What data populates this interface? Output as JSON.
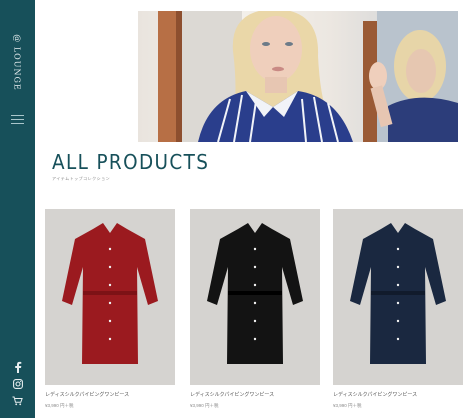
{
  "sidebar": {
    "logo_text": "@ LOUNGE",
    "icons": [
      "menu-icon",
      "facebook-icon",
      "instagram-icon",
      "cart-icon"
    ]
  },
  "hero": {
    "image": "woman in blue-and-white striped pajama shirt beside a mirror"
  },
  "page": {
    "title": "ALL PRODUCTS",
    "subtitle": "アイテムトップコレクション"
  },
  "products": [
    {
      "name": "レディスシルクパイピングワンピース",
      "price": "¥3,990 円＋税",
      "color": "#9b1a1f"
    },
    {
      "name": "レディスシルクパイピングワンピース",
      "price": "¥3,990 円＋税",
      "color": "#131313"
    },
    {
      "name": "レディスシルクパイピングワンピース",
      "price": "¥3,990 円＋税",
      "color": "#1a2840"
    }
  ],
  "colors": {
    "sidebar": "#17505a",
    "title": "#17505a",
    "product_background": "#d5d3d0"
  }
}
